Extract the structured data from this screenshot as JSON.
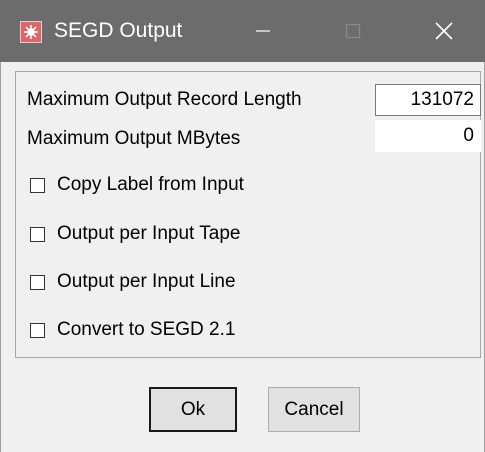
{
  "window": {
    "title": "SEGD Output",
    "icon": "app-icon",
    "controls": [
      "minimize-icon",
      "maximize-icon",
      "close-icon"
    ]
  },
  "fields": {
    "max_record_length": {
      "label": "Maximum Output Record Length",
      "value": "131072"
    },
    "max_mbytes": {
      "label": "Maximum Output MBytes",
      "value": "0"
    }
  },
  "checkboxes": [
    {
      "label": "Copy Label from Input",
      "checked": false
    },
    {
      "label": "Output per Input Tape",
      "checked": false
    },
    {
      "label": "Output per Input Line",
      "checked": false
    },
    {
      "label": "Convert to SEGD 2.1",
      "checked": false
    }
  ],
  "buttons": {
    "ok": "Ok",
    "cancel": "Cancel"
  },
  "colors": {
    "titlebar": "#6c6c6c",
    "window_bg": "#f0f0f0",
    "icon_bg": "#d9686a"
  }
}
